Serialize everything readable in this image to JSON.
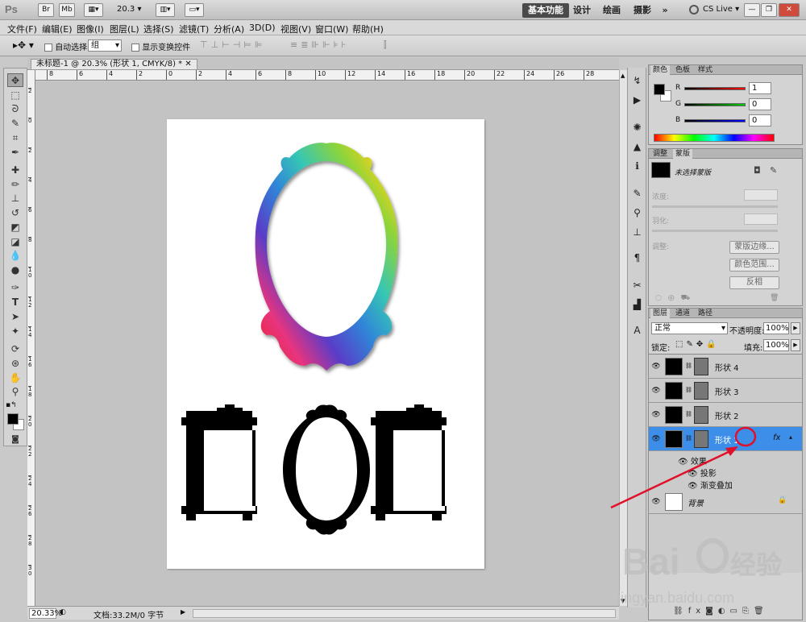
{
  "app": {
    "logo": "Ps",
    "bridge_btn": "Br",
    "mini_bridge_btn": "Mb",
    "zoom_value": "20.3",
    "workspaces": [
      "基本功能",
      "设计",
      "绘画",
      "摄影"
    ],
    "more_workspaces": "»",
    "cs_live": "CS Live",
    "window_buttons": [
      "—",
      "❐",
      "✕"
    ]
  },
  "menu": [
    "文件(F)",
    "编辑(E)",
    "图像(I)",
    "图层(L)",
    "选择(S)",
    "滤镜(T)",
    "分析(A)",
    "3D(D)",
    "视图(V)",
    "窗口(W)",
    "帮助(H)"
  ],
  "options": {
    "auto_select_label": "自动选择:",
    "auto_select_value": "组",
    "show_transform_label": "显示变换控件"
  },
  "document": {
    "tab_title": "未标题-1 @ 20.3% (形状 1, CMYK/8) *",
    "ruler_top": [
      "8",
      "6",
      "4",
      "2",
      "0",
      "2",
      "4",
      "6",
      "8",
      "10",
      "12",
      "14",
      "16",
      "18",
      "20",
      "22",
      "24",
      "26",
      "28"
    ],
    "ruler_left": [
      "2",
      "0",
      "2",
      "4",
      "6",
      "8",
      "1\n0",
      "1\n2",
      "1\n4",
      "1\n6",
      "1\n8",
      "2\n0",
      "2\n2",
      "2\n4",
      "2\n6",
      "2\n8",
      "3\n0"
    ],
    "zoom_status": "20.33%",
    "doc_status": "文档:33.2M/0 字节"
  },
  "color_panel": {
    "tabs": [
      "颜色",
      "色板",
      "样式"
    ],
    "r_label": "R",
    "r_value": "1",
    "g_label": "G",
    "g_value": "0",
    "b_label": "B",
    "b_value": "0"
  },
  "masks_panel": {
    "tabs": [
      "调整",
      "蒙版"
    ],
    "no_mask": "未选择蒙版",
    "density_label": "浓度:",
    "feather_label": "羽化:",
    "refine_label": "调整:",
    "mask_edge_btn": "蒙版边缘...",
    "color_range_btn": "颜色范围...",
    "invert_btn": "反相"
  },
  "layers_panel": {
    "tabs": [
      "图层",
      "通道",
      "路径"
    ],
    "blend_mode": "正常",
    "opacity_label": "不透明度:",
    "opacity_value": "100%",
    "lock_label": "锁定:",
    "fill_label": "填充:",
    "fill_value": "100%",
    "layers": [
      {
        "name": "形状 4"
      },
      {
        "name": "形状 3"
      },
      {
        "name": "形状 2"
      },
      {
        "name": "形状 1"
      }
    ],
    "effects_label": "效果",
    "effect_shadow": "投影",
    "effect_gradient": "渐变叠加",
    "background_name": "背景",
    "fx_label": "fx"
  },
  "watermark": {
    "brand": "Bai",
    "brand_cn": "经验",
    "url": "jingyan.baidu.com"
  },
  "colors": {
    "selected_layer": "#3d8ee8",
    "annotation_red": "#e0102a"
  }
}
